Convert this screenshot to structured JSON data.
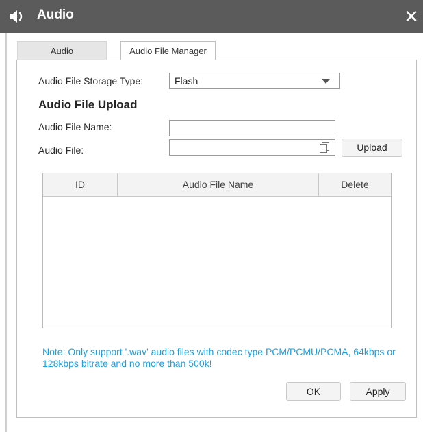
{
  "window": {
    "title": "Audio",
    "close_symbol": "✕",
    "title_icon": "speaker-icon"
  },
  "tabs": [
    {
      "label": "Audio",
      "active": false
    },
    {
      "label": "Audio File Manager",
      "active": true
    }
  ],
  "storage": {
    "label": "Audio File Storage Type:",
    "value": "Flash"
  },
  "upload": {
    "section_title": "Audio File Upload",
    "name_label": "Audio File Name:",
    "name_value": "",
    "file_label": "Audio File:",
    "file_value": "",
    "upload_button": "Upload"
  },
  "table": {
    "columns": [
      "ID",
      "Audio File Name",
      "Delete"
    ],
    "rows": []
  },
  "note": "Note: Only support '.wav' audio files with codec type PCM/PCMU/PCMA, 64kbps or 128kbps bitrate and no more than 500k!",
  "buttons": {
    "ok": "OK",
    "apply": "Apply"
  },
  "colors": {
    "titlebar": "#5b5b5b",
    "note": "#1aa0e0"
  }
}
